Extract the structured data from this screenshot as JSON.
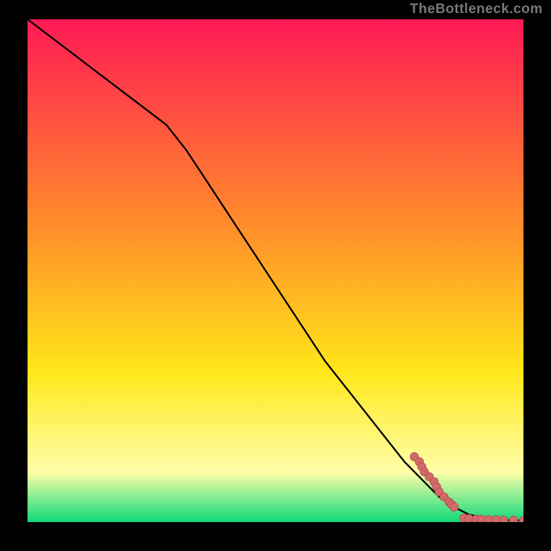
{
  "watermark": "TheBottleneck.com",
  "colors": {
    "frame": "#000000",
    "line": "#000000",
    "point_fill": "#d36a6a",
    "point_stroke": "#b84d4d"
  },
  "chart_data": {
    "type": "line",
    "title": "",
    "xlabel": "",
    "ylabel": "",
    "xlim": [
      0,
      100
    ],
    "ylim": [
      0,
      100
    ],
    "grid": false,
    "background_gradient": {
      "top": "#ff1a55",
      "mid_orange": "#ff8a2b",
      "mid_yellow": "#ffe619",
      "pale_yellow": "#ffffa8",
      "green": "#10d97a"
    },
    "series": [
      {
        "name": "curve",
        "x": [
          0,
          4,
          8,
          12,
          16,
          20,
          24,
          28,
          32,
          36,
          40,
          44,
          48,
          52,
          56,
          60,
          64,
          68,
          72,
          76,
          80,
          83,
          86,
          89,
          92,
          95,
          100
        ],
        "y": [
          100,
          97,
          94,
          91,
          88,
          85,
          82,
          79,
          74,
          68,
          62,
          56,
          50,
          44,
          38,
          32,
          27,
          22,
          17,
          12,
          8,
          5,
          3,
          1.5,
          0.8,
          0.4,
          0.3
        ]
      }
    ],
    "scatter": [
      {
        "x": 78,
        "y": 13
      },
      {
        "x": 79,
        "y": 12
      },
      {
        "x": 79.5,
        "y": 11
      },
      {
        "x": 80,
        "y": 10
      },
      {
        "x": 81,
        "y": 9
      },
      {
        "x": 82,
        "y": 8
      },
      {
        "x": 82.5,
        "y": 7
      },
      {
        "x": 83,
        "y": 6
      },
      {
        "x": 84,
        "y": 5
      },
      {
        "x": 85,
        "y": 4
      },
      {
        "x": 85.5,
        "y": 3.5
      },
      {
        "x": 86,
        "y": 3
      },
      {
        "x": 88,
        "y": 0.8
      },
      {
        "x": 89,
        "y": 0.7
      },
      {
        "x": 90.5,
        "y": 0.6
      },
      {
        "x": 91.5,
        "y": 0.55
      },
      {
        "x": 93,
        "y": 0.5
      },
      {
        "x": 94.5,
        "y": 0.45
      },
      {
        "x": 96,
        "y": 0.4
      },
      {
        "x": 98,
        "y": 0.35
      },
      {
        "x": 100,
        "y": 0.3
      }
    ]
  }
}
